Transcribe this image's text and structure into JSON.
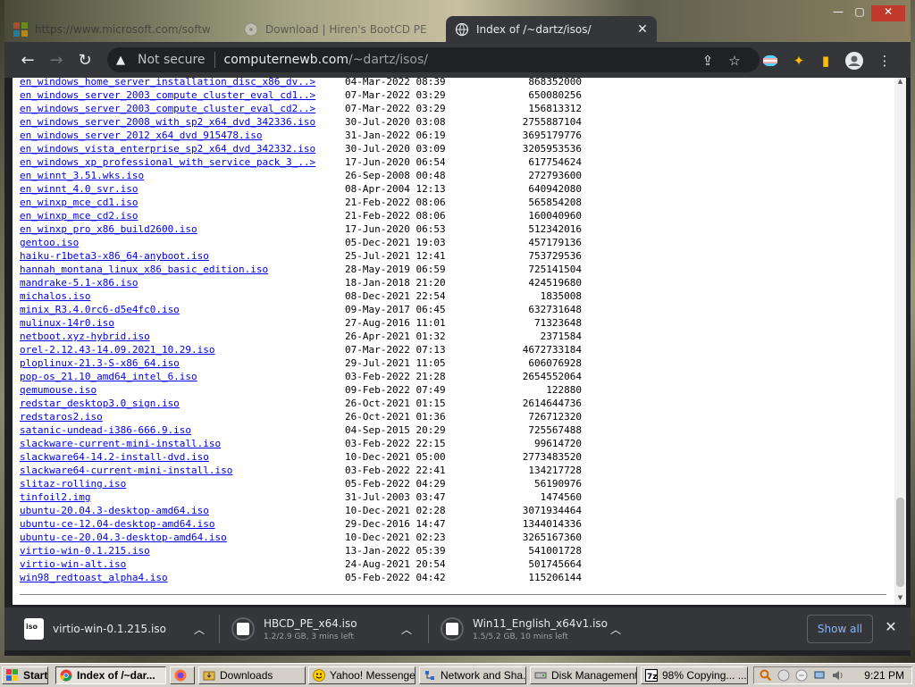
{
  "browser": {
    "tabs": [
      {
        "title": "https://www.microsoft.com/softw",
        "active": false
      },
      {
        "title": "Download | Hiren's BootCD PE",
        "active": false
      },
      {
        "title": "Index of /~dartz/isos/",
        "active": true
      }
    ],
    "address": {
      "security_label": "Not secure",
      "url_host": "computernewb.com",
      "url_path": "/~dartz/isos/"
    }
  },
  "listing": [
    {
      "name": "en_windows_home_server_installation_disc_x86_dv..>",
      "date": "04-Mar-2022 08:39",
      "size": "868352000"
    },
    {
      "name": "en_windows_server_2003_compute_cluster_eval_cd1..>",
      "date": "07-Mar-2022 03:29",
      "size": "650080256"
    },
    {
      "name": "en_windows_server_2003_compute_cluster_eval_cd2..>",
      "date": "07-Mar-2022 03:29",
      "size": "156813312"
    },
    {
      "name": "en_windows_server_2008_with_sp2_x64_dvd_342336.iso",
      "date": "30-Jul-2020 03:08",
      "size": "2755887104"
    },
    {
      "name": "en_windows_server_2012_x64_dvd_915478.iso",
      "date": "31-Jan-2022 06:19",
      "size": "3695179776"
    },
    {
      "name": "en_windows_vista_enterprise_sp2_x64_dvd_342332.iso",
      "date": "30-Jul-2020 03:09",
      "size": "3205953536"
    },
    {
      "name": "en_windows_xp_professional_with_service_pack_3_..>",
      "date": "17-Jun-2020 06:54",
      "size": "617754624"
    },
    {
      "name": "en_winnt_3.51.wks.iso",
      "date": "26-Sep-2008 00:48",
      "size": "272793600"
    },
    {
      "name": "en_winnt_4.0_svr.iso",
      "date": "08-Apr-2004 12:13",
      "size": "640942080"
    },
    {
      "name": "en_winxp_mce_cd1.iso",
      "date": "21-Feb-2022 08:06",
      "size": "565854208"
    },
    {
      "name": "en_winxp_mce_cd2.iso",
      "date": "21-Feb-2022 08:06",
      "size": "160040960"
    },
    {
      "name": "en_winxp_pro_x86_build2600.iso",
      "date": "17-Jun-2020 06:53",
      "size": "512342016"
    },
    {
      "name": "gentoo.iso",
      "date": "05-Dec-2021 19:03",
      "size": "457179136"
    },
    {
      "name": "haiku-r1beta3-x86_64-anyboot.iso",
      "date": "25-Jul-2021 12:41",
      "size": "753729536"
    },
    {
      "name": "hannah_montana_linux_x86_basic_edition.iso",
      "date": "28-May-2019 06:59",
      "size": "725141504"
    },
    {
      "name": "mandrake-5.1-x86.iso",
      "date": "18-Jan-2018 21:20",
      "size": "424519680"
    },
    {
      "name": "michalos.iso",
      "date": "08-Dec-2021 22:54",
      "size": "1835008"
    },
    {
      "name": "minix_R3.4.0rc6-d5e4fc0.iso",
      "date": "09-May-2017 06:45",
      "size": "632731648"
    },
    {
      "name": "mulinux-14r0.iso",
      "date": "27-Aug-2016 11:01",
      "size": "71323648"
    },
    {
      "name": "netboot.xyz-hybrid.iso",
      "date": "26-Apr-2021 01:32",
      "size": "2371584"
    },
    {
      "name": "orel-2.12.43-14.09.2021_10.29.iso",
      "date": "07-Mar-2022 07:13",
      "size": "4672733184"
    },
    {
      "name": "ploplinux-21.3-S-x86_64.iso",
      "date": "29-Jul-2021 11:05",
      "size": "606076928"
    },
    {
      "name": "pop-os_21.10_amd64_intel_6.iso",
      "date": "03-Feb-2022 21:28",
      "size": "2654552064"
    },
    {
      "name": "qemumouse.iso",
      "date": "09-Feb-2022 07:49",
      "size": "122880"
    },
    {
      "name": "redstar_desktop3.0_sign.iso",
      "date": "26-Oct-2021 01:15",
      "size": "2614644736"
    },
    {
      "name": "redstaros2.iso",
      "date": "26-Oct-2021 01:36",
      "size": "726712320"
    },
    {
      "name": "satanic-undead-i386-666.9.iso",
      "date": "04-Sep-2015 20:29",
      "size": "725567488"
    },
    {
      "name": "slackware-current-mini-install.iso",
      "date": "03-Feb-2022 22:15",
      "size": "99614720"
    },
    {
      "name": "slackware64-14.2-install-dvd.iso",
      "date": "10-Dec-2021 05:00",
      "size": "2773483520"
    },
    {
      "name": "slackware64-current-mini-install.iso",
      "date": "03-Feb-2022 22:41",
      "size": "134217728"
    },
    {
      "name": "slitaz-rolling.iso",
      "date": "05-Feb-2022 04:29",
      "size": "56190976"
    },
    {
      "name": "tinfoil2.img",
      "date": "31-Jul-2003 03:47",
      "size": "1474560"
    },
    {
      "name": "ubuntu-20.04.3-desktop-amd64.iso",
      "date": "10-Dec-2021 02:28",
      "size": "3071934464"
    },
    {
      "name": "ubuntu-ce-12.04-desktop-amd64.iso",
      "date": "29-Dec-2016 14:47",
      "size": "1344014336"
    },
    {
      "name": "ubuntu-ce-20.04.3-desktop-amd64.iso",
      "date": "10-Dec-2021 02:23",
      "size": "3265167360"
    },
    {
      "name": "virtio-win-0.1.215.iso",
      "date": "13-Jan-2022 05:39",
      "size": "541001728"
    },
    {
      "name": "virtio-win-alt.iso",
      "date": "24-Aug-2021 20:54",
      "size": "501745664"
    },
    {
      "name": "win98_redtoast_alpha4.iso",
      "date": "05-Feb-2022 04:42",
      "size": "115206144"
    }
  ],
  "downloads": {
    "items": [
      {
        "name": "virtio-win-0.1.215.iso",
        "status": ""
      },
      {
        "name": "HBCD_PE_x64.iso",
        "status": "1.2/2.9 GB, 3 mins left"
      },
      {
        "name": "Win11_English_x64v1.iso",
        "status": "1.5/5.2 GB, 10 mins left"
      }
    ],
    "show_all_label": "Show all"
  },
  "taskbar": {
    "start_label": "Start",
    "buttons": [
      {
        "label": "Index of /~dar...",
        "pressed": true
      },
      {
        "label": "",
        "pressed": false
      },
      {
        "label": "Downloads",
        "pressed": false
      },
      {
        "label": "Yahoo! Messenger",
        "pressed": false
      },
      {
        "label": "Network and Sha...",
        "pressed": false
      },
      {
        "label": "Disk Management",
        "pressed": false
      },
      {
        "label": "98% Copying... ...",
        "pressed": false
      }
    ],
    "clock": "9:21 PM"
  },
  "colors": {
    "link": "#0000ee",
    "chrome_dark": "#35363a",
    "accent": "#8ab4f8"
  }
}
